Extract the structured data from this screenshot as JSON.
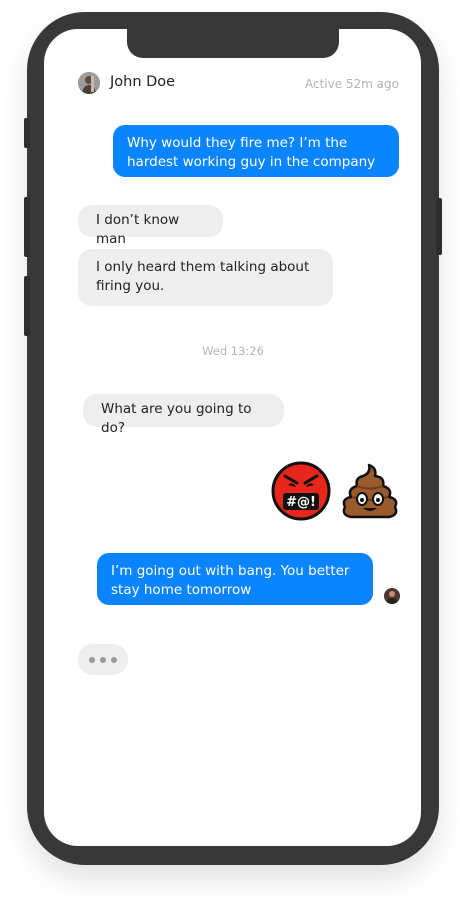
{
  "header": {
    "contact_name": "John Doe",
    "status": "Active 52m ago",
    "avatar_icon": "contact-avatar"
  },
  "messages": [
    {
      "from": "me",
      "text": "Why would they fire me?  I’m the hardest working guy in the company"
    },
    {
      "from": "them",
      "text": "I don’t know man"
    },
    {
      "from": "them",
      "text": "I only heard them talking about firing you."
    },
    {
      "from": "them",
      "text": "What are you going to do?"
    },
    {
      "from": "me",
      "text": "I’m going out with bang. You better stay home tomorrow"
    }
  ],
  "timestamp": "Wed 13:26",
  "emoji_message": {
    "emojis": [
      {
        "name": "face-with-symbols-on-mouth",
        "glyph_text": "#@!"
      },
      {
        "name": "pile-of-poo"
      }
    ]
  },
  "typing_indicator": {
    "icon": "typing-dots"
  },
  "colors": {
    "outgoing_bubble": "#0a84ff",
    "incoming_bubble": "#eeeeee",
    "device_frame": "#383838"
  }
}
